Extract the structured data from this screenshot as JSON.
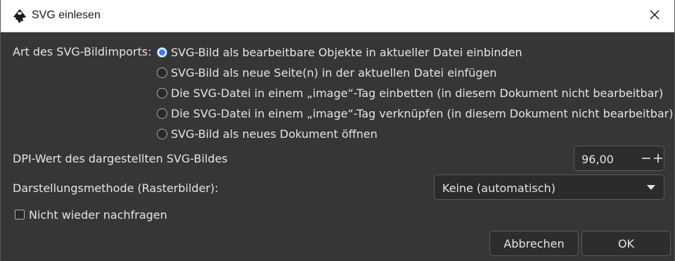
{
  "window": {
    "title": "SVG einlesen",
    "icon": "inkscape-logo-icon",
    "close_icon": "close-icon"
  },
  "import_type": {
    "label": "Art des SVG-Bildimports:",
    "options": [
      {
        "label": "SVG-Bild als bearbeitbare Objekte in aktueller Datei einbinden",
        "selected": true
      },
      {
        "label": "SVG-Bild als neue Seite(n) in der aktuellen Datei einfügen",
        "selected": false
      },
      {
        "label": "Die SVG-Datei in einem „image“-Tag einbetten (in diesem Dokument nicht bearbeitbar)",
        "selected": false
      },
      {
        "label": "Die SVG-Datei in einem „image“-Tag verknüpfen (in diesem Dokument nicht bearbeitbar)",
        "selected": false
      },
      {
        "label": "SVG-Bild als neues Dokument öffnen",
        "selected": false
      }
    ]
  },
  "dpi": {
    "label": "DPI-Wert des dargestellten SVG-Bildes",
    "value": "96,00",
    "minus": "−",
    "plus": "+"
  },
  "render_method": {
    "label": "Darstellungsmethode (Rasterbilder):",
    "value": "Keine (automatisch)"
  },
  "dont_ask": {
    "label": "Nicht wieder nachfragen",
    "checked": false
  },
  "buttons": {
    "cancel": "Abbrechen",
    "ok": "OK"
  },
  "colors": {
    "dialog_bg": "#363636",
    "titlebar_bg": "#ffffff",
    "accent": "#3a7df0"
  }
}
